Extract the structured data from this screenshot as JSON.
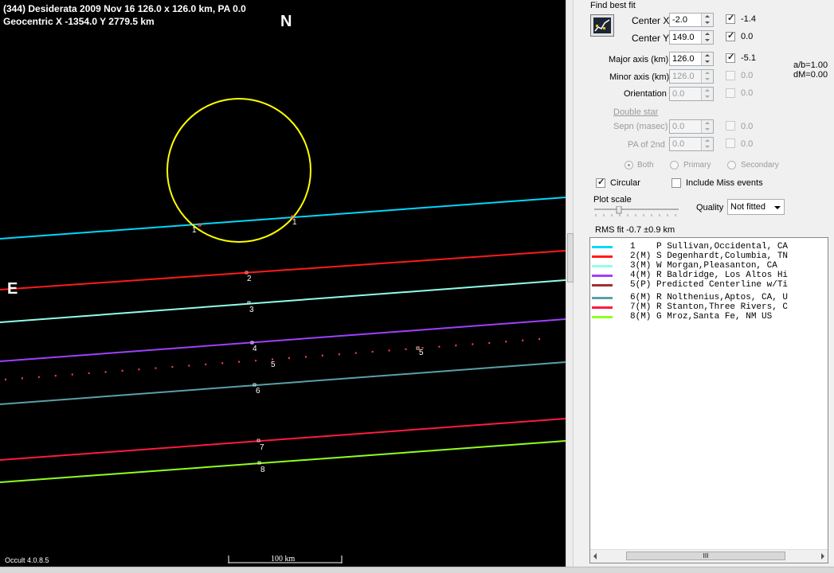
{
  "plot": {
    "title_line1": "(344) Desiderata  2009 Nov 16   126.0 x 126.0 km, PA 0.0",
    "title_line2": "Geocentric  X  -1354.0  Y 2779.5 km",
    "north_label": "N",
    "east_label": "E",
    "version": "Occult 4.0.8.5",
    "scale_label": "100 km",
    "ellipse_color": "#ffff00",
    "chords": [
      {
        "id": "1",
        "color": "#00d8ff"
      },
      {
        "id": "2",
        "color": "#ff1a1a"
      },
      {
        "id": "3",
        "color": "#90ffe8"
      },
      {
        "id": "4",
        "color": "#a040ff"
      },
      {
        "id": "5",
        "color": "#ff4040",
        "style": "dotted"
      },
      {
        "id": "6",
        "color": "#5aa0a8"
      },
      {
        "id": "7",
        "color": "#ff1a40"
      },
      {
        "id": "8",
        "color": "#90ff20"
      }
    ]
  },
  "panel": {
    "find_best_fit": "Find best fit",
    "center_x_label": "Center X",
    "center_x_value": "-2.0",
    "center_x_delta": "-1.4",
    "center_x_checked": true,
    "center_y_label": "Center Y",
    "center_y_value": "149.0",
    "center_y_delta": "0.0",
    "center_y_checked": true,
    "major_label": "Major axis (km)",
    "major_value": "126.0",
    "major_delta": "-5.1",
    "major_checked": true,
    "minor_label": "Minor axis (km)",
    "minor_value": "126.0",
    "minor_delta": "0.0",
    "orient_label": "Orientation",
    "orient_value": "0.0",
    "orient_delta": "0.0",
    "ab_ratio": "a/b=1.00",
    "dm": "dM=0.00",
    "double_star": "Double star",
    "sepn_label": "Sepn (masec)",
    "sepn_value": "0.0",
    "sepn_delta": "0.0",
    "pa2_label": "PA of 2nd",
    "pa2_value": "0.0",
    "pa2_delta": "0.0",
    "radio_both": "Both",
    "radio_primary": "Primary",
    "radio_secondary": "Secondary",
    "circular_label": "Circular",
    "include_miss_label": "Include Miss events",
    "plot_scale_label": "Plot scale",
    "quality_label": "Quality",
    "quality_value": "Not fitted",
    "rms_fit": "RMS fit -0.7 ±0.9 km"
  },
  "observers": [
    {
      "color": "#00d8ff",
      "text": "1    P Sullivan,Occidental, CA"
    },
    {
      "color": "#ff1a1a",
      "text": "2(M) S Degenhardt,Columbia, TN"
    },
    {
      "color": "#90ffe8",
      "text": "3(M) W Morgan,Pleasanton, CA"
    },
    {
      "color": "#a040ff",
      "text": "4(M) R Baldridge, Los Altos Hi"
    },
    {
      "color": "#a03030",
      "text": "5(P) Predicted Centerline w/Ti"
    },
    {
      "color": "#5aa0a8",
      "text": "6(M) R Nolthenius,Aptos, CA, U"
    },
    {
      "color": "#ff1a40",
      "text": "7(M) R Stanton,Three Rivers, C"
    },
    {
      "color": "#90ff20",
      "text": "8(M) G Mroz,Santa Fe, NM US"
    }
  ],
  "scroll_thumb": "III"
}
